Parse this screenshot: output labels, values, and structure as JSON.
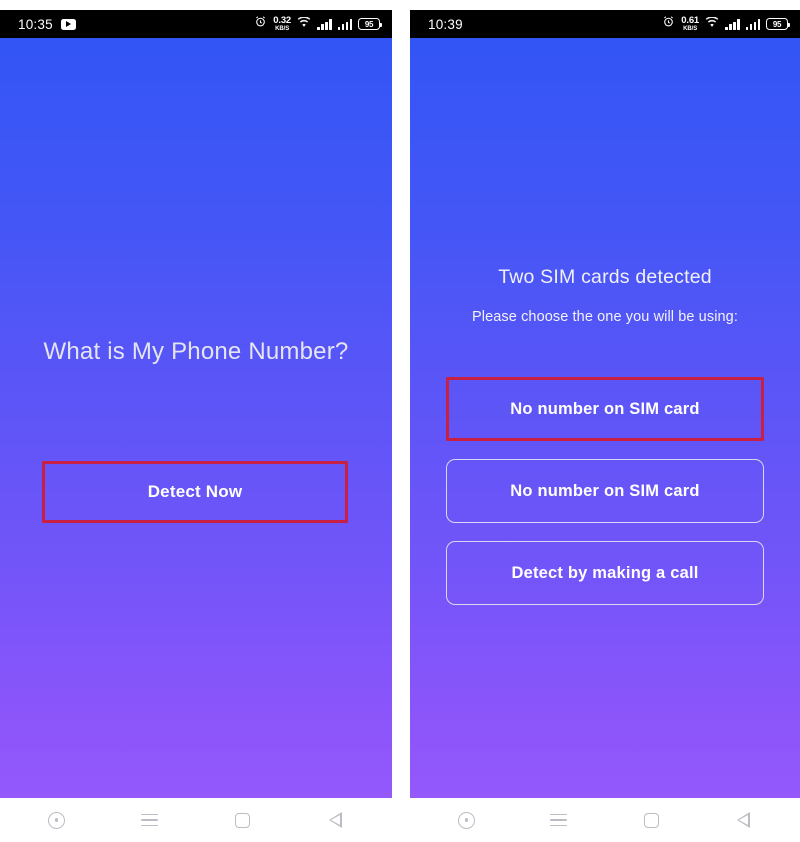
{
  "screens": [
    {
      "id": "left",
      "status_bar": {
        "time": "10:35",
        "app_icon": "youtube-icon",
        "alarm_icon": "alarm-clock-icon",
        "net_speed_value": "0.32",
        "net_speed_unit": "KB/S",
        "wifi_icon": "wifi-icon",
        "signal_icon_1": "signal-bars-icon",
        "signal_icon_2": "signal-bars-icon",
        "battery_level": "95"
      },
      "heading": "What is My Phone Number?",
      "primary_button": "Detect Now",
      "highlight_color": "#c81f45"
    },
    {
      "id": "right",
      "status_bar": {
        "time": "10:39",
        "alarm_icon": "alarm-clock-icon",
        "net_speed_value": "0.61",
        "net_speed_unit": "KB/S",
        "wifi_icon": "wifi-icon",
        "signal_icon_1": "signal-bars-icon",
        "signal_icon_2": "signal-bars-icon",
        "battery_level": "95"
      },
      "heading": "Two SIM cards detected",
      "subtitle": "Please choose the one you will be using:",
      "options": [
        {
          "label": "No number on SIM card",
          "highlighted": true
        },
        {
          "label": "No number on SIM card",
          "highlighted": false
        },
        {
          "label": "Detect by making a call",
          "highlighted": false
        }
      ],
      "highlight_color": "#c81f45"
    }
  ],
  "nav_bar": {
    "buttons": [
      {
        "name": "assistant-icon"
      },
      {
        "name": "menu-icon"
      },
      {
        "name": "home-icon"
      },
      {
        "name": "back-icon"
      }
    ]
  },
  "theme": {
    "gradient_top": "#3355f5",
    "gradient_bottom": "#9458fb",
    "annotation_red": "#c81f45",
    "button_border": "#d8d8ee",
    "text_on_gradient": "#ffffff"
  }
}
